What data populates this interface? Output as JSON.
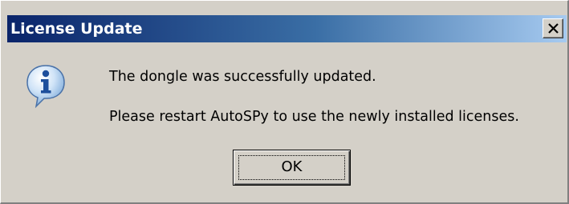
{
  "dialog": {
    "title": "License Update",
    "close_icon": "close-icon",
    "info_icon": "information-icon",
    "message_line1": "The dongle was successfully updated.",
    "message_line2": "Please restart AutoSPy to use the newly installed licenses.",
    "ok_label": "OK"
  },
  "colors": {
    "title_gradient_start": "#0a246a",
    "title_gradient_end": "#a6caf0",
    "dialog_background": "#d4d0c8",
    "title_text": "#ffffff"
  }
}
